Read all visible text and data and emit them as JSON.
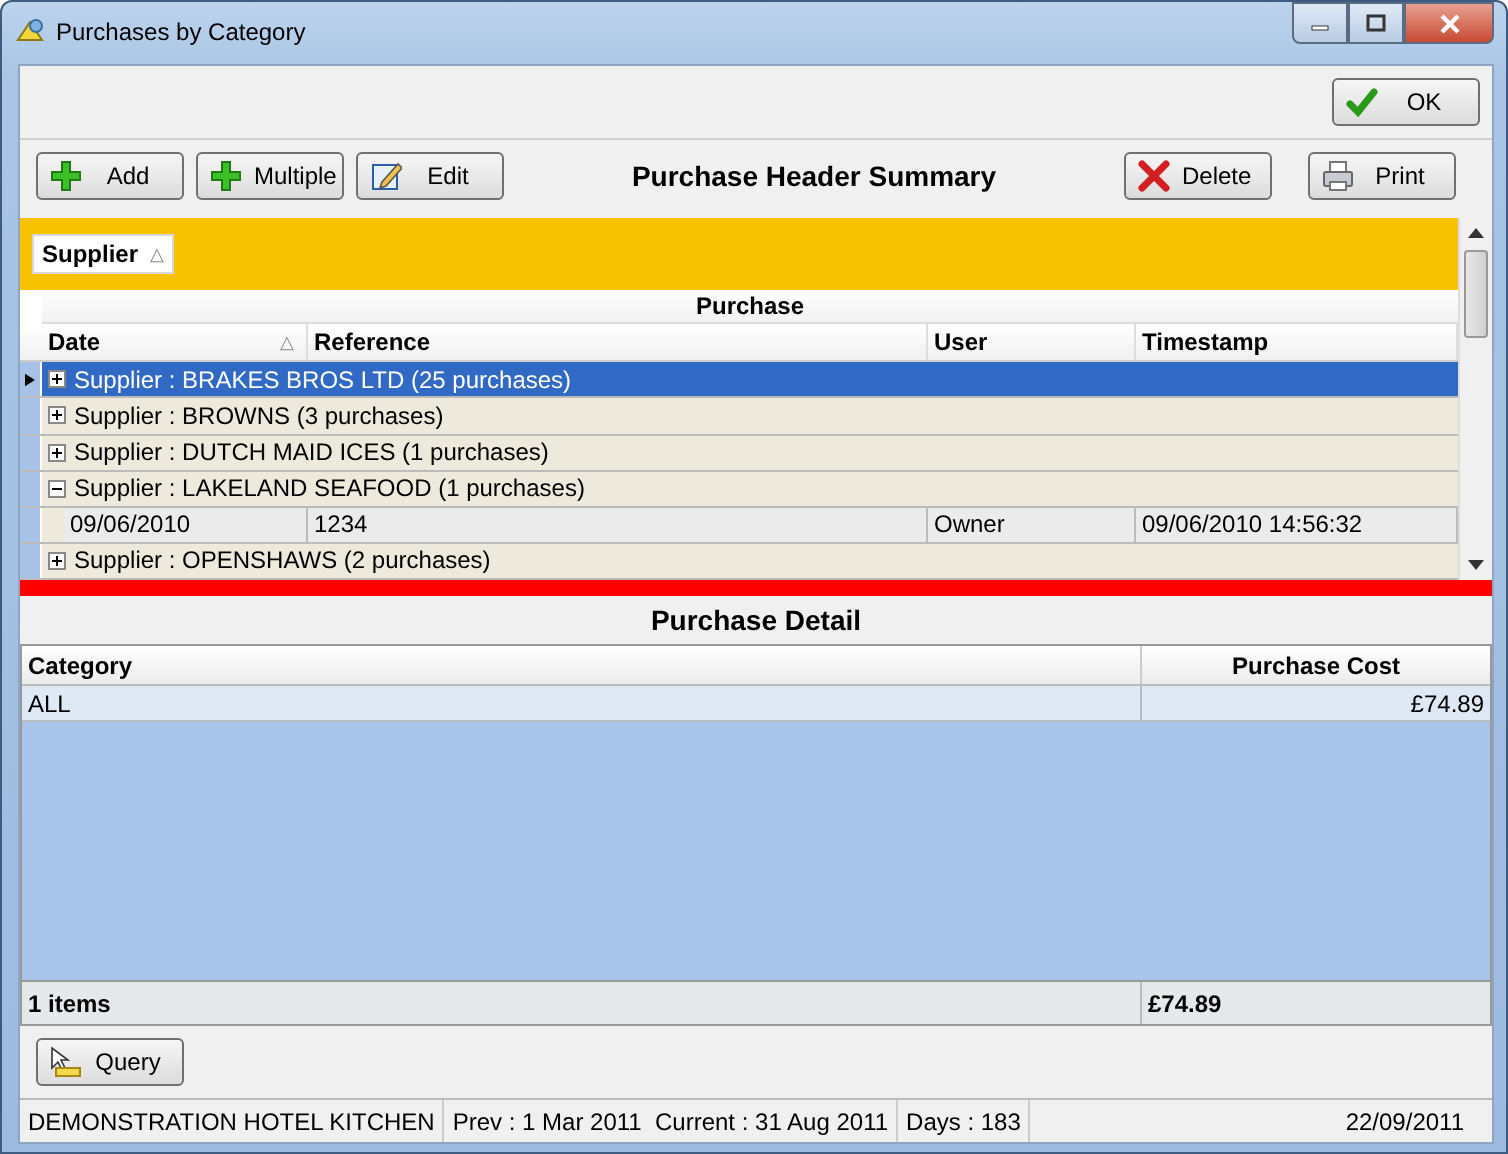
{
  "window": {
    "title": "Purchases by Category"
  },
  "top_buttons": [
    {
      "label": "OK",
      "kind": "check"
    }
  ],
  "toolbar": {
    "title": "Purchase Header Summary",
    "left_buttons": [
      {
        "label": "Add",
        "kind": "plus"
      },
      {
        "label": "Multiple",
        "kind": "plus"
      },
      {
        "label": "Edit",
        "kind": "edit"
      }
    ],
    "right_buttons": [
      {
        "label": "Delete",
        "kind": "cross"
      },
      {
        "label": "Print",
        "kind": "printer"
      }
    ]
  },
  "grouping": {
    "chips": [
      {
        "label": "Supplier",
        "sort_mark": "△"
      }
    ]
  },
  "purchase_grid": {
    "band": "Purchase",
    "columns": [
      {
        "label": "Date",
        "sort_mark": "△"
      },
      {
        "label": "Reference"
      },
      {
        "label": "User"
      },
      {
        "label": "Timestamp"
      }
    ],
    "groups": [
      {
        "label": "Supplier : BRAKES BROS LTD (25 purchases)",
        "expanded": false,
        "selected": true
      },
      {
        "label": "Supplier : BROWNS (3 purchases)",
        "expanded": false,
        "selected": false
      },
      {
        "label": "Supplier : DUTCH MAID ICES (1 purchases)",
        "expanded": false,
        "selected": false
      },
      {
        "label": "Supplier : LAKELAND SEAFOOD (1 purchases)",
        "expanded": true,
        "selected": false,
        "children": [
          {
            "cells": [
              "09/06/2010",
              "1234",
              "Owner",
              "09/06/2010 14:56:32"
            ]
          }
        ]
      },
      {
        "label": "Supplier : OPENSHAWS (2 purchases)",
        "expanded": false,
        "selected": false
      }
    ]
  },
  "detail": {
    "title": "Purchase Detail",
    "columns": [
      "Category",
      "Purchase Cost"
    ],
    "rows": [
      {
        "cells": [
          "ALL",
          "£74.89"
        ]
      }
    ],
    "footer": [
      "1 items",
      "£74.89"
    ]
  },
  "bottom_buttons": [
    {
      "label": "Query",
      "kind": "query"
    }
  ],
  "status_bar": [
    "DEMONSTRATION HOTEL KITCHEN",
    "Prev : 1 Mar 2011  Current : 31 Aug 2011",
    "Days : 183",
    "22/09/2011"
  ]
}
